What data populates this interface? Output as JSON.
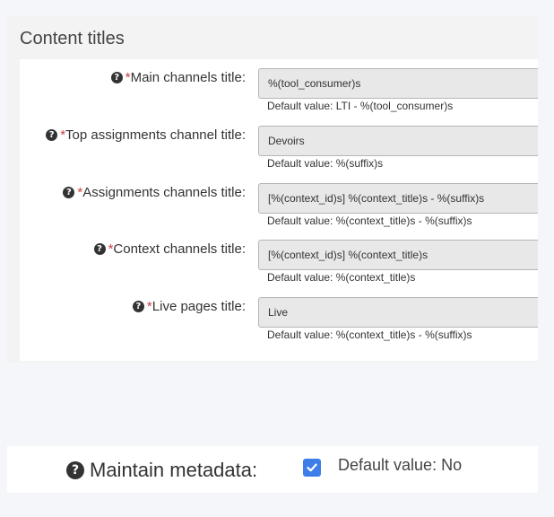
{
  "section": {
    "title": "Content titles",
    "help_glyph": "?",
    "fields": [
      {
        "label": "Main channels title:",
        "value": "%(tool_consumer)s",
        "default": "Default value: LTI - %(tool_consumer)s"
      },
      {
        "label": "Top assignments channel title:",
        "value": "Devoirs",
        "default": "Default value: %(suffix)s"
      },
      {
        "label": "Assignments channels title:",
        "value": "[%(context_id)s] %(context_title)s - %(suffix)s",
        "default": "Default value: %(context_title)s - %(suffix)s"
      },
      {
        "label": "Context channels title:",
        "value": "[%(context_id)s] %(context_title)s",
        "default": "Default value: %(context_title)s"
      },
      {
        "label": "Live pages title:",
        "value": "Live",
        "default": "Default value: %(context_title)s - %(suffix)s"
      }
    ],
    "required_mark": "*"
  },
  "metadata": {
    "label": "Maintain metadata:",
    "checked": true,
    "default": "Default value: No"
  },
  "colors": {
    "required": "#c83c3c",
    "checkbox": "#3d7ee8"
  },
  "icons": {
    "help": "question-circle-icon",
    "check": "check-icon"
  }
}
